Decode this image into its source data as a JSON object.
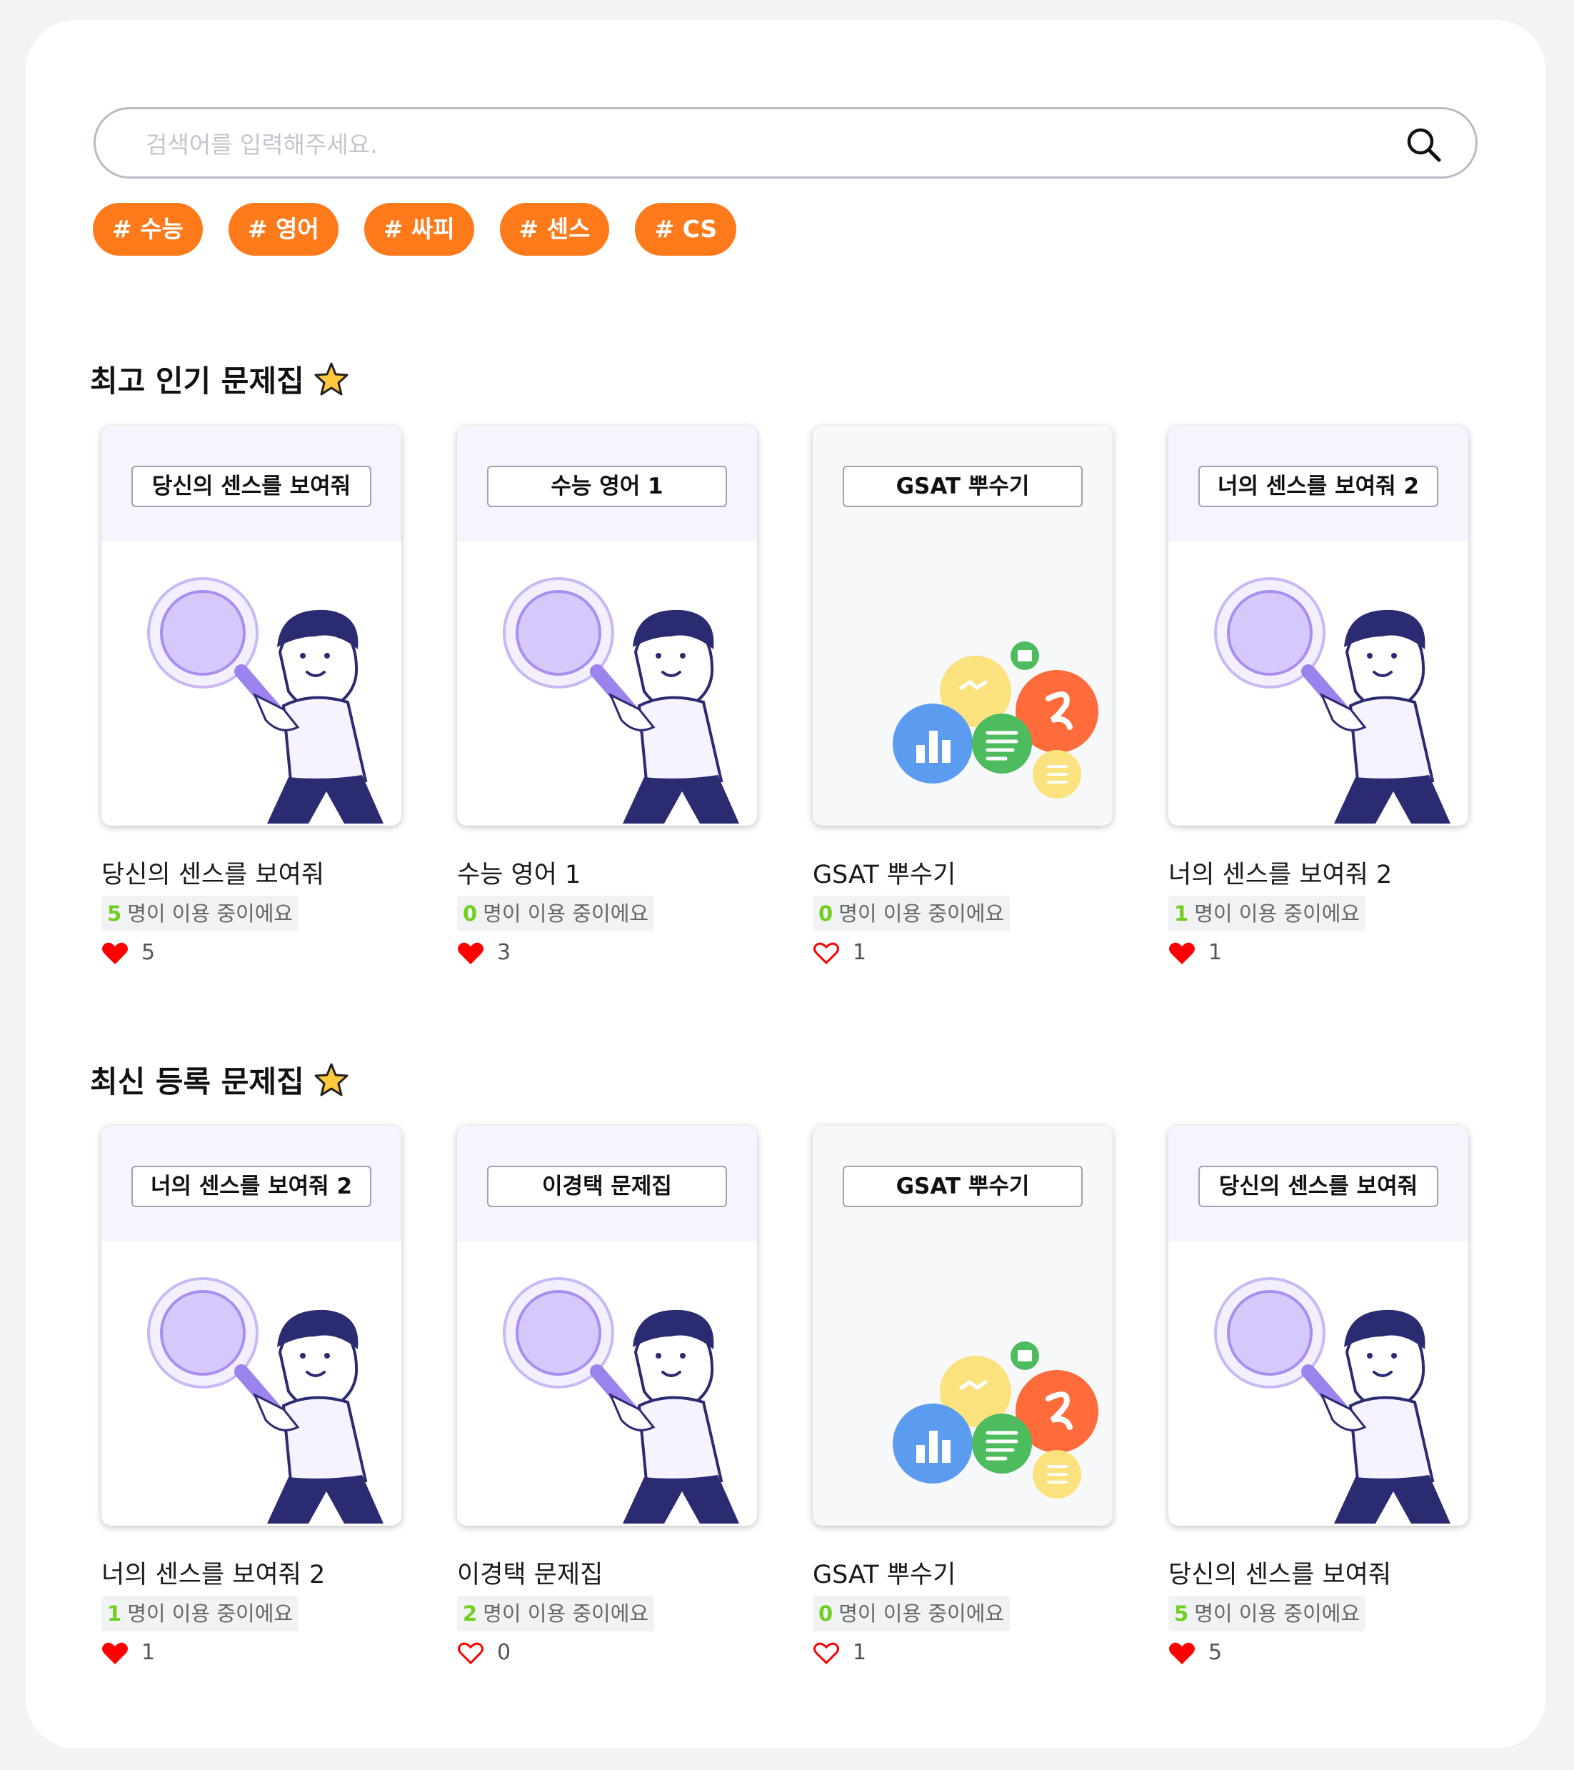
{
  "search": {
    "placeholder": "검색어를 입력해주세요."
  },
  "tags": [
    "# 수능",
    "# 영어",
    "# 싸피",
    "# 센스",
    "# CS"
  ],
  "sections": [
    {
      "title": "최고 인기 문제집",
      "cards": [
        {
          "label": "당신의 센스를 보여줘",
          "title": "당신의 센스를 보여줘",
          "users": "5",
          "users_suffix": "명이 이용 중이에요",
          "likes": "5",
          "liked": true,
          "image": "magnifier-person"
        },
        {
          "label": "수능 영어 1",
          "title": "수능 영어 1",
          "users": "0",
          "users_suffix": "명이 이용 중이에요",
          "likes": "3",
          "liked": true,
          "image": "magnifier-person"
        },
        {
          "label": "GSAT 뿌수기",
          "title": "GSAT 뿌수기",
          "users": "0",
          "users_suffix": "명이 이용 중이에요",
          "likes": "1",
          "liked": false,
          "image": "colored-circles"
        },
        {
          "label": "너의 센스를 보여줘 2",
          "title": "너의 센스를 보여줘 2",
          "users": "1",
          "users_suffix": "명이 이용 중이에요",
          "likes": "1",
          "liked": true,
          "image": "magnifier-person"
        }
      ]
    },
    {
      "title": "최신 등록 문제집",
      "cards": [
        {
          "label": "너의 센스를 보여줘 2",
          "title": "너의 센스를 보여줘 2",
          "users": "1",
          "users_suffix": "명이 이용 중이에요",
          "likes": "1",
          "liked": true,
          "image": "magnifier-person"
        },
        {
          "label": "이경택 문제집",
          "title": "이경택 문제집",
          "users": "2",
          "users_suffix": "명이 이용 중이에요",
          "likes": "0",
          "liked": false,
          "image": "magnifier-person"
        },
        {
          "label": "GSAT 뿌수기",
          "title": "GSAT 뿌수기",
          "users": "0",
          "users_suffix": "명이 이용 중이에요",
          "likes": "1",
          "liked": false,
          "image": "colored-circles"
        },
        {
          "label": "당신의 센스를 보여줘",
          "title": "당신의 센스를 보여줘",
          "users": "5",
          "users_suffix": "명이 이용 중이에요",
          "likes": "5",
          "liked": true,
          "image": "magnifier-person"
        }
      ]
    }
  ],
  "colors": {
    "tag": "#ff7a1a",
    "heart": "#ff0000",
    "count": "#6fcf1e",
    "star": "#ffc83d"
  }
}
